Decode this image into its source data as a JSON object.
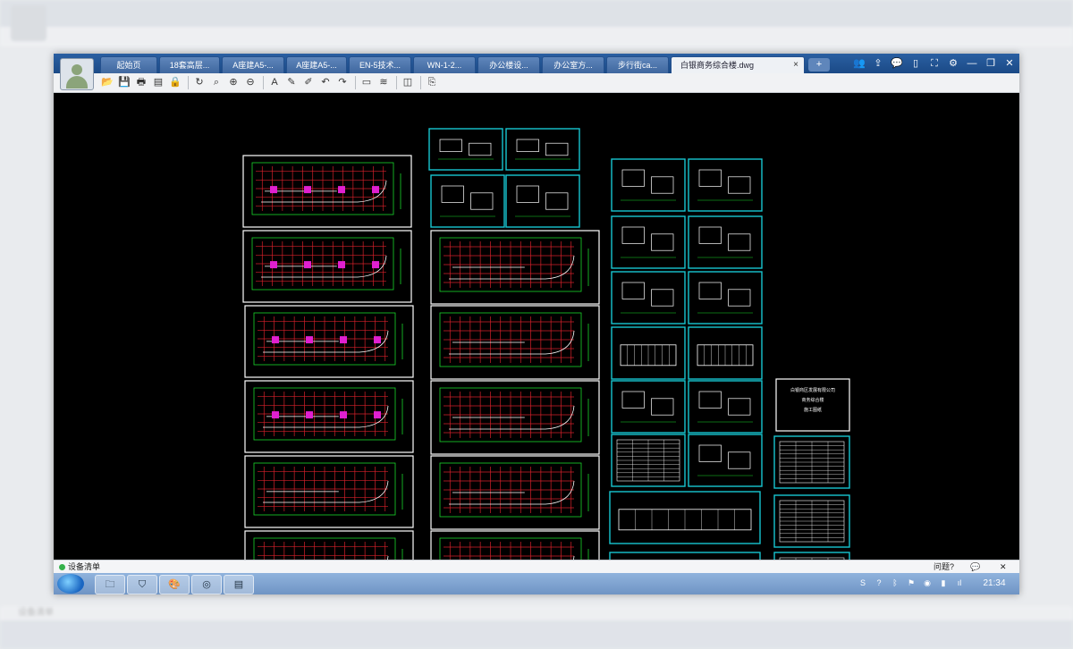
{
  "ghost": {
    "tabs": [
      "起始页",
      "18套高层...",
      "A座建A5-...",
      "A座建A5-...",
      "EN-5技术...",
      "WN-1-2...",
      "办公楼设...",
      "办公室方...",
      "步行街ca...",
      "白银商务综合楼.dwg"
    ],
    "status_label": "设备清单"
  },
  "window": {
    "tabs": [
      {
        "label": "起始页"
      },
      {
        "label": "18套高层..."
      },
      {
        "label": "A座建A5-..."
      },
      {
        "label": "A座建A5-..."
      },
      {
        "label": "EN-5技术..."
      },
      {
        "label": "WN-1-2..."
      },
      {
        "label": "办公楼设..."
      },
      {
        "label": "办公室方..."
      },
      {
        "label": "步行街ca..."
      },
      {
        "label": "白银商务综合楼.dwg",
        "active": true
      }
    ],
    "new_tab_label": "+",
    "tab_close_glyph": "×",
    "window_controls": [
      {
        "name": "contacts-icon",
        "glyph": "👥"
      },
      {
        "name": "share-icon",
        "glyph": "⇪"
      },
      {
        "name": "chat-icon",
        "glyph": "💬"
      },
      {
        "name": "mobile-icon",
        "glyph": "▯"
      },
      {
        "name": "fullscreen-icon",
        "glyph": "⛶"
      },
      {
        "name": "settings-icon",
        "glyph": "⚙"
      },
      {
        "name": "minimize-icon",
        "glyph": "—"
      },
      {
        "name": "restore-icon",
        "glyph": "❐"
      },
      {
        "name": "close-icon",
        "glyph": "✕"
      }
    ],
    "toolbar": [
      {
        "name": "open-icon",
        "glyph": "📂"
      },
      {
        "name": "save-icon",
        "glyph": "💾"
      },
      {
        "name": "print-icon",
        "glyph": "🖶"
      },
      {
        "name": "pdf-icon",
        "glyph": "▤"
      },
      {
        "name": "lock-icon",
        "glyph": "🔒"
      },
      {
        "name": "sep"
      },
      {
        "name": "rotate-icon",
        "glyph": "↻"
      },
      {
        "name": "zoom-window-icon",
        "glyph": "⌕"
      },
      {
        "name": "zoom-in-icon",
        "glyph": "⊕"
      },
      {
        "name": "zoom-out-icon",
        "glyph": "⊖"
      },
      {
        "name": "sep"
      },
      {
        "name": "text-icon",
        "glyph": "A"
      },
      {
        "name": "pencil-icon",
        "glyph": "✎"
      },
      {
        "name": "markup-icon",
        "glyph": "✐"
      },
      {
        "name": "undo-icon",
        "glyph": "↶"
      },
      {
        "name": "redo-icon",
        "glyph": "↷"
      },
      {
        "name": "sep"
      },
      {
        "name": "measure-icon",
        "glyph": "▭"
      },
      {
        "name": "measure-area-icon",
        "glyph": "≋"
      },
      {
        "name": "sep"
      },
      {
        "name": "layers-icon",
        "glyph": "◫"
      },
      {
        "name": "sep"
      },
      {
        "name": "export-icon",
        "glyph": "⎘"
      }
    ],
    "status": {
      "left_label": "设备清单",
      "feedback_label": "问题?",
      "chat_glyph": "💬",
      "close_glyph": "✕"
    },
    "taskbar": {
      "apps": [
        {
          "name": "explorer-icon",
          "glyph": "🗀"
        },
        {
          "name": "media-icon",
          "glyph": "⛉"
        },
        {
          "name": "paint-icon",
          "glyph": "🎨"
        },
        {
          "name": "ie-icon",
          "glyph": "◎"
        },
        {
          "name": "books-icon",
          "glyph": "▤"
        }
      ],
      "tray": [
        {
          "name": "input-method-icon",
          "glyph": "S"
        },
        {
          "name": "help-icon",
          "glyph": "?"
        },
        {
          "name": "bluetooth-icon",
          "glyph": "ᛒ"
        },
        {
          "name": "flag-icon",
          "glyph": "⚑"
        },
        {
          "name": "network-icon",
          "glyph": "◉"
        },
        {
          "name": "battery-icon",
          "glyph": "▮"
        },
        {
          "name": "signal-icon",
          "glyph": "ıl"
        }
      ],
      "clock": "21:34"
    }
  },
  "drawing": {
    "title_block": [
      "白银商区发展有限公司",
      "商务综合楼",
      "施工图纸"
    ],
    "colors": {
      "background": "#000000",
      "frame": "#ffffff",
      "cyan_frame": "#17c6d0",
      "grid": "#d4202a",
      "dim": "#18d62b",
      "accent": "#e020d0"
    }
  }
}
